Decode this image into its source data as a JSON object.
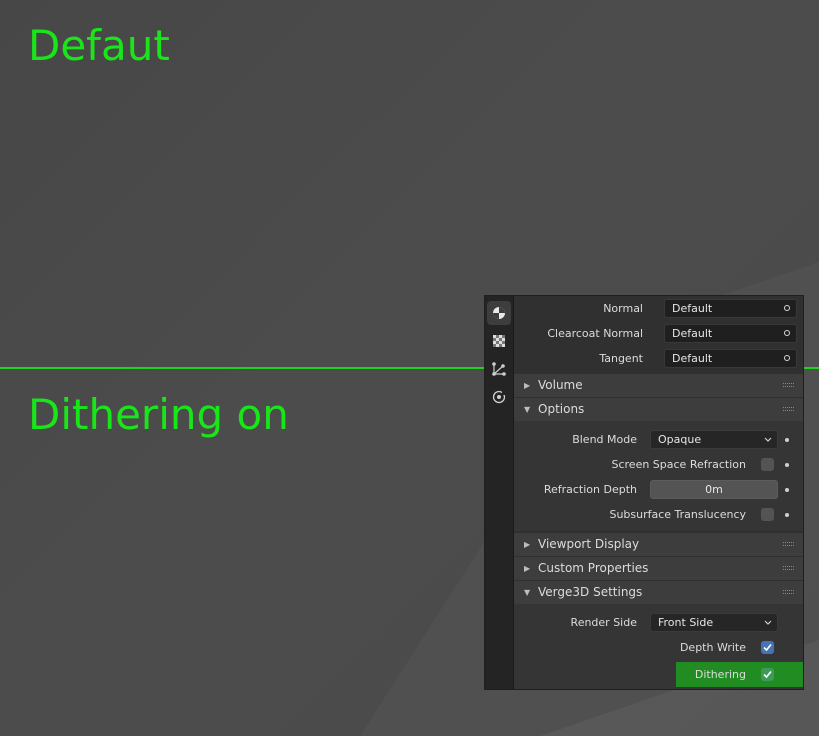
{
  "captions": {
    "top": "Defaut",
    "bottom": "Dithering on"
  },
  "colors": {
    "caption": "#19e619",
    "split_line": "#1ed41e",
    "highlight": "#218c21",
    "checkbox_on": "#4772b3"
  },
  "tabs": [
    {
      "icon": "material-icon",
      "active": true
    },
    {
      "icon": "texture-icon",
      "active": false
    },
    {
      "icon": "node-tree-icon",
      "active": false
    },
    {
      "icon": "physics-icon",
      "active": false
    }
  ],
  "inputs": {
    "normal": {
      "label": "Normal",
      "value": "Default"
    },
    "clearcoat_normal": {
      "label": "Clearcoat Normal",
      "value": "Default"
    },
    "tangent": {
      "label": "Tangent",
      "value": "Default"
    }
  },
  "sections": {
    "volume": {
      "title": "Volume",
      "expanded": false
    },
    "options": {
      "title": "Options",
      "expanded": true
    },
    "viewport_display": {
      "title": "Viewport Display",
      "expanded": false
    },
    "custom_properties": {
      "title": "Custom Properties",
      "expanded": false
    },
    "verge3d": {
      "title": "Verge3D Settings",
      "expanded": true
    }
  },
  "options": {
    "blend_mode": {
      "label": "Blend Mode",
      "value": "Opaque"
    },
    "ssr": {
      "label": "Screen Space Refraction",
      "checked": false
    },
    "refraction_depth": {
      "label": "Refraction Depth",
      "value": "0m"
    },
    "subsurface": {
      "label": "Subsurface Translucency",
      "checked": false
    }
  },
  "verge3d": {
    "render_side": {
      "label": "Render Side",
      "value": "Front Side"
    },
    "depth_write": {
      "label": "Depth Write",
      "checked": true
    },
    "dithering": {
      "label": "Dithering",
      "checked": true
    }
  }
}
